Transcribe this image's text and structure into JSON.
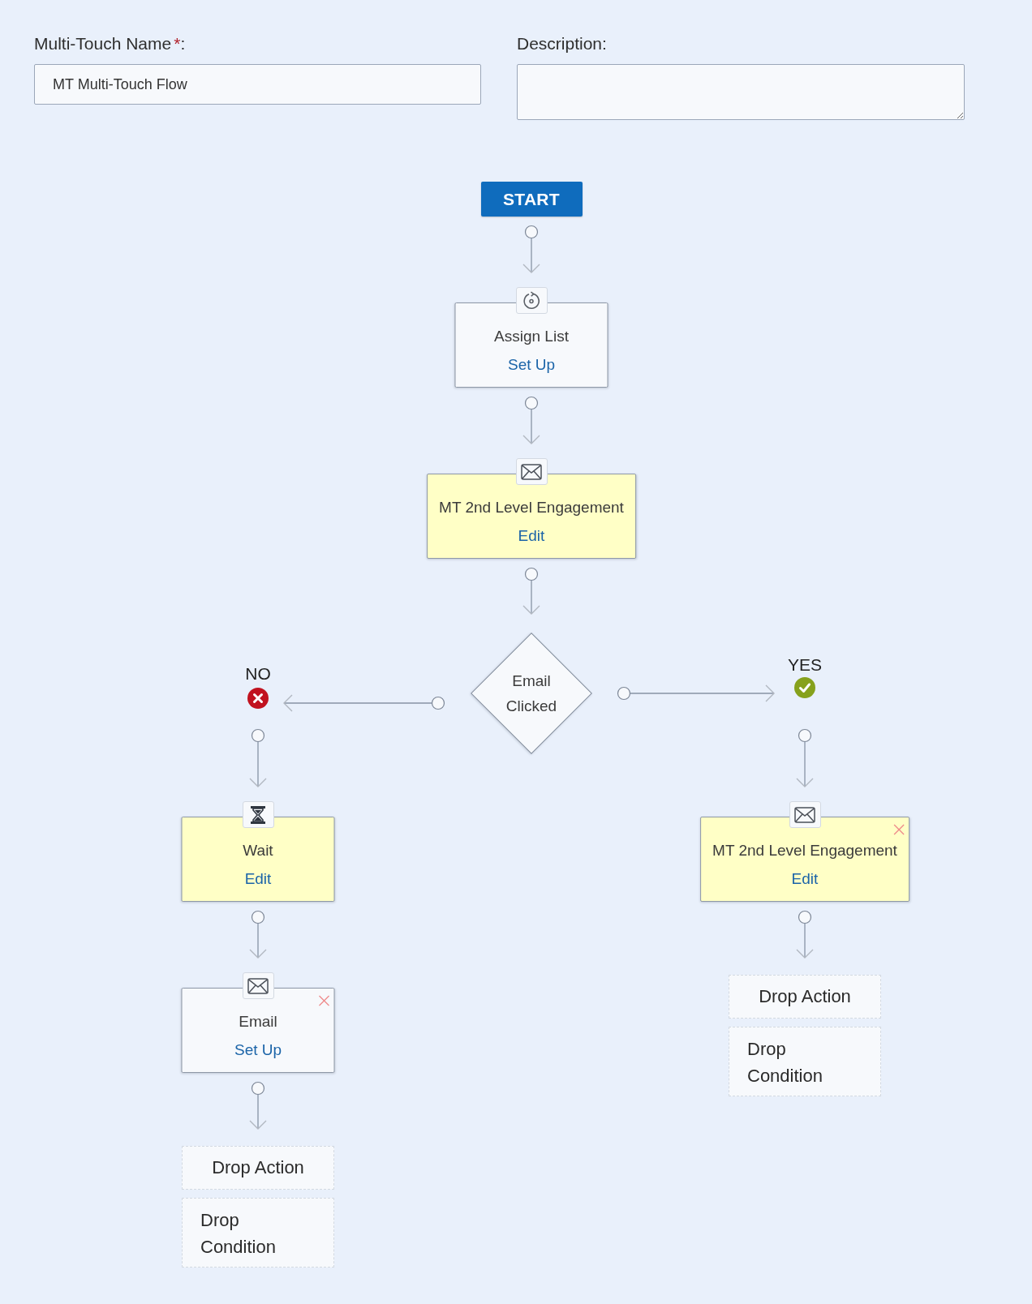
{
  "form": {
    "name_field": {
      "label": "Multi-Touch Name",
      "required_mark": "*",
      "label_suffix": ":",
      "value": "MT Multi-Touch Flow"
    },
    "description_field": {
      "label": "Description:"
    }
  },
  "flow": {
    "start": {
      "label": "START"
    },
    "steps": [
      {
        "kind": "assign_list",
        "title": "Assign List",
        "link": "Set Up",
        "configured": false,
        "deletable": false
      },
      {
        "kind": "email",
        "title": "MT 2nd Level Engagement",
        "link": "Edit",
        "configured": true,
        "deletable": false
      }
    ],
    "decision": {
      "label": "Email Clicked"
    },
    "branches": [
      {
        "kind": "no",
        "label": "NO",
        "steps": [
          {
            "kind": "wait",
            "title": "Wait",
            "link": "Edit",
            "configured": true,
            "deletable": false
          },
          {
            "kind": "email",
            "title": "Email",
            "link": "Set Up",
            "configured": false,
            "deletable": true
          }
        ],
        "drop_zones": [
          {
            "kind": "action",
            "label": "Drop Action"
          },
          {
            "kind": "condition",
            "label": "Drop Condition"
          }
        ]
      },
      {
        "kind": "yes",
        "label": "YES",
        "steps": [
          {
            "kind": "email",
            "title": "MT 2nd Level Engagement",
            "link": "Edit",
            "configured": true,
            "deletable": true
          }
        ],
        "drop_zones": [
          {
            "kind": "action",
            "label": "Drop Action"
          },
          {
            "kind": "condition",
            "label": "Drop Condition"
          }
        ]
      }
    ]
  }
}
